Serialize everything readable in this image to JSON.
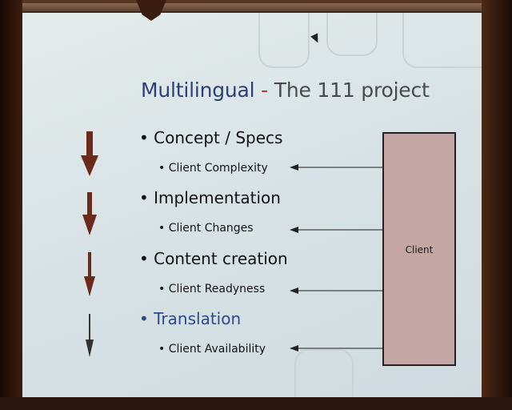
{
  "slide": {
    "title_brand": "Multilingual",
    "title_sep": " - ",
    "title_rest": "The 111 project",
    "items": [
      {
        "main": "Concept / Specs",
        "sub": "Client Complexity"
      },
      {
        "main": "Implementation",
        "sub": "Client Changes"
      },
      {
        "main": "Content creation",
        "sub": "Client Readyness"
      },
      {
        "main": "Translation",
        "sub": "Client Availability"
      }
    ],
    "client_label": "Client",
    "bullet_glyph": "•",
    "colors": {
      "title_brand": "#2d3f78",
      "translation": "#2c4a8c",
      "client_box": "#c4a7a4",
      "arrow": "#6a2a1c"
    }
  }
}
